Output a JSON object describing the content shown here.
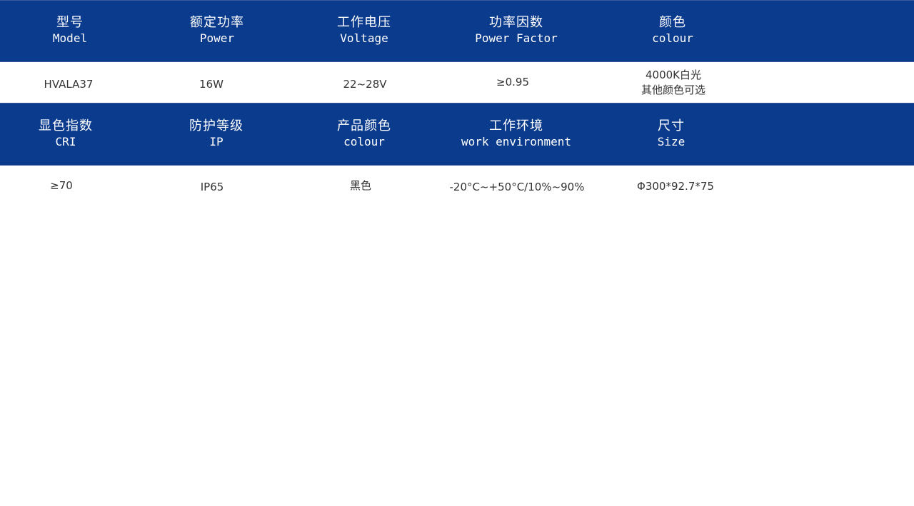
{
  "table": {
    "section1": {
      "headers": [
        {
          "zh": "型号",
          "en": "Model"
        },
        {
          "zh": "额定功率",
          "en": "Power"
        },
        {
          "zh": "工作电压",
          "en": "Voltage"
        },
        {
          "zh": "功率因数",
          "en": "Power Factor"
        },
        {
          "zh": "颜色",
          "en": "colour"
        }
      ],
      "values": [
        "HVALA37",
        "16W",
        "22~28V",
        "≥0.95",
        [
          "4000K白光",
          "其他颜色可选"
        ]
      ]
    },
    "section2": {
      "headers": [
        {
          "zh": "显色指数",
          "en": "CRI"
        },
        {
          "zh": "防护等级",
          "en": "IP"
        },
        {
          "zh": "产品颜色",
          "en": "colour"
        },
        {
          "zh": "工作环境",
          "en": "work environment"
        },
        {
          "zh": "尺寸",
          "en": "Size"
        }
      ],
      "values": [
        "≥70",
        "IP65",
        "黑色",
        "-20°C~+50°C/10%~90%",
        "Φ300*92.7*75"
      ]
    }
  },
  "colors": {
    "header_band": "#0b3b8c",
    "header_text": "#ffffff",
    "value_text": "#333333"
  }
}
